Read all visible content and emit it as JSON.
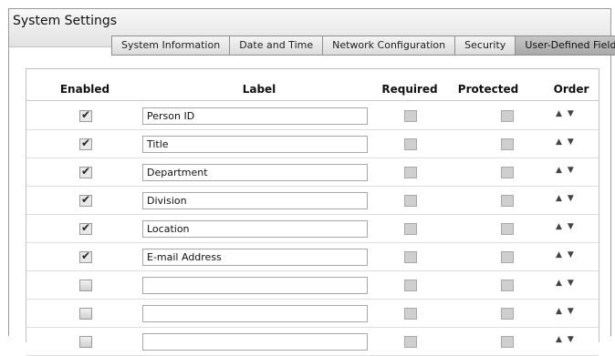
{
  "window": {
    "title": "System Settings"
  },
  "tabs": [
    {
      "label": "System Information"
    },
    {
      "label": "Date and Time"
    },
    {
      "label": "Network Configuration"
    },
    {
      "label": "Security"
    },
    {
      "label": "User-Defined Fields",
      "active": true
    }
  ],
  "table": {
    "headers": {
      "enabled": "Enabled",
      "label": "Label",
      "required": "Required",
      "protected": "Protected",
      "order": "Order"
    },
    "rows": [
      {
        "enabled": true,
        "label": "Person ID",
        "required": false,
        "protected": false
      },
      {
        "enabled": true,
        "label": "Title",
        "required": false,
        "protected": false
      },
      {
        "enabled": true,
        "label": "Department",
        "required": false,
        "protected": false
      },
      {
        "enabled": true,
        "label": "Division",
        "required": false,
        "protected": false
      },
      {
        "enabled": true,
        "label": "Location",
        "required": false,
        "protected": false
      },
      {
        "enabled": true,
        "label": "E-mail Address",
        "required": false,
        "protected": false
      },
      {
        "enabled": false,
        "label": "",
        "required": false,
        "protected": false
      },
      {
        "enabled": false,
        "label": "",
        "required": false,
        "protected": false
      },
      {
        "enabled": false,
        "label": "",
        "required": false,
        "protected": false
      }
    ],
    "order_icons": {
      "up": "▲",
      "down": "▼"
    }
  },
  "icons": {
    "checkbox_checked": "check-icon",
    "order_up": "arrow-up-icon",
    "order_down": "arrow-down-icon"
  }
}
